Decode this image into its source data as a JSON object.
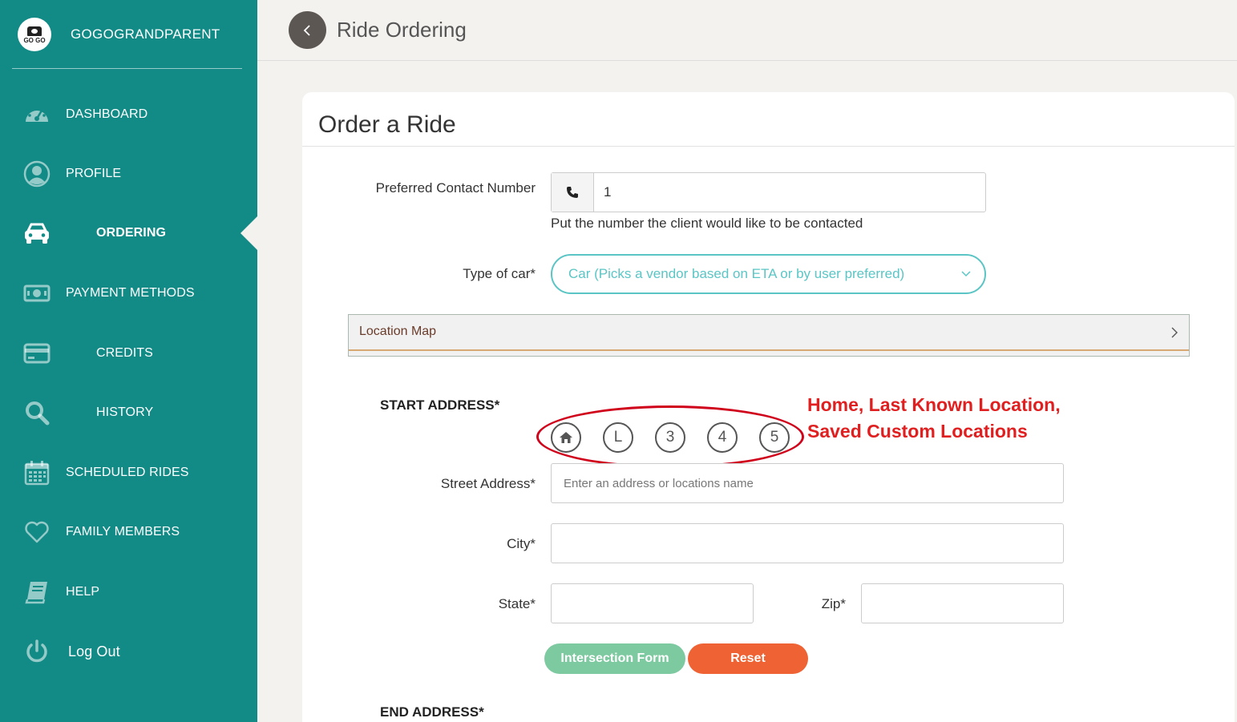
{
  "sidebar": {
    "brand_logo_text": "GO GO",
    "brand_name": "GOGOGRANDPARENT",
    "items": [
      {
        "label": "DASHBOARD",
        "icon": "dashboard-gauge-icon"
      },
      {
        "label": "PROFILE",
        "icon": "user-circle-icon"
      },
      {
        "label": "ORDERING",
        "icon": "car-icon",
        "active": true
      },
      {
        "label": "PAYMENT METHODS",
        "icon": "money-bill-icon"
      },
      {
        "label": "CREDITS",
        "icon": "credit-card-icon"
      },
      {
        "label": "HISTORY",
        "icon": "search-icon"
      },
      {
        "label": "SCHEDULED RIDES",
        "icon": "calendar-icon"
      },
      {
        "label": "FAMILY MEMBERS",
        "icon": "heart-icon"
      },
      {
        "label": "HELP",
        "icon": "book-icon"
      },
      {
        "label": "Log Out",
        "icon": "power-icon"
      }
    ],
    "background_color": "#128a86"
  },
  "header": {
    "title": "Ride Ordering"
  },
  "form": {
    "title": "Order a Ride",
    "contact": {
      "label": "Preferred Contact Number",
      "value": "1",
      "help": "Put the number the client would like to be contacted"
    },
    "car_type": {
      "label": "Type of car*",
      "selected": "Car (Picks a vendor based on ETA or by user preferred)"
    },
    "map_panel": {
      "label": "Location Map"
    },
    "start": {
      "title": "START ADDRESS*",
      "saved_locations": [
        {
          "label": "",
          "icon": "home-icon"
        },
        {
          "label": "L"
        },
        {
          "label": "3"
        },
        {
          "label": "4"
        },
        {
          "label": "5"
        }
      ],
      "street_label": "Street Address*",
      "street_placeholder": "Enter an address or locations name",
      "city_label": "City*",
      "state_label": "State*",
      "zip_label": "Zip*"
    },
    "buttons": {
      "intersection": "Intersection Form",
      "reset": "Reset"
    },
    "end": {
      "title": "END ADDRESS*"
    }
  },
  "annotation": {
    "line1": "Home, Last Known Location,",
    "line2": "Saved Custom Locations"
  },
  "colors": {
    "accent": "#5bc5c5",
    "intersection_button": "#7dc9a0",
    "reset_button": "#ee6233",
    "annotation_red": "#e02020"
  }
}
